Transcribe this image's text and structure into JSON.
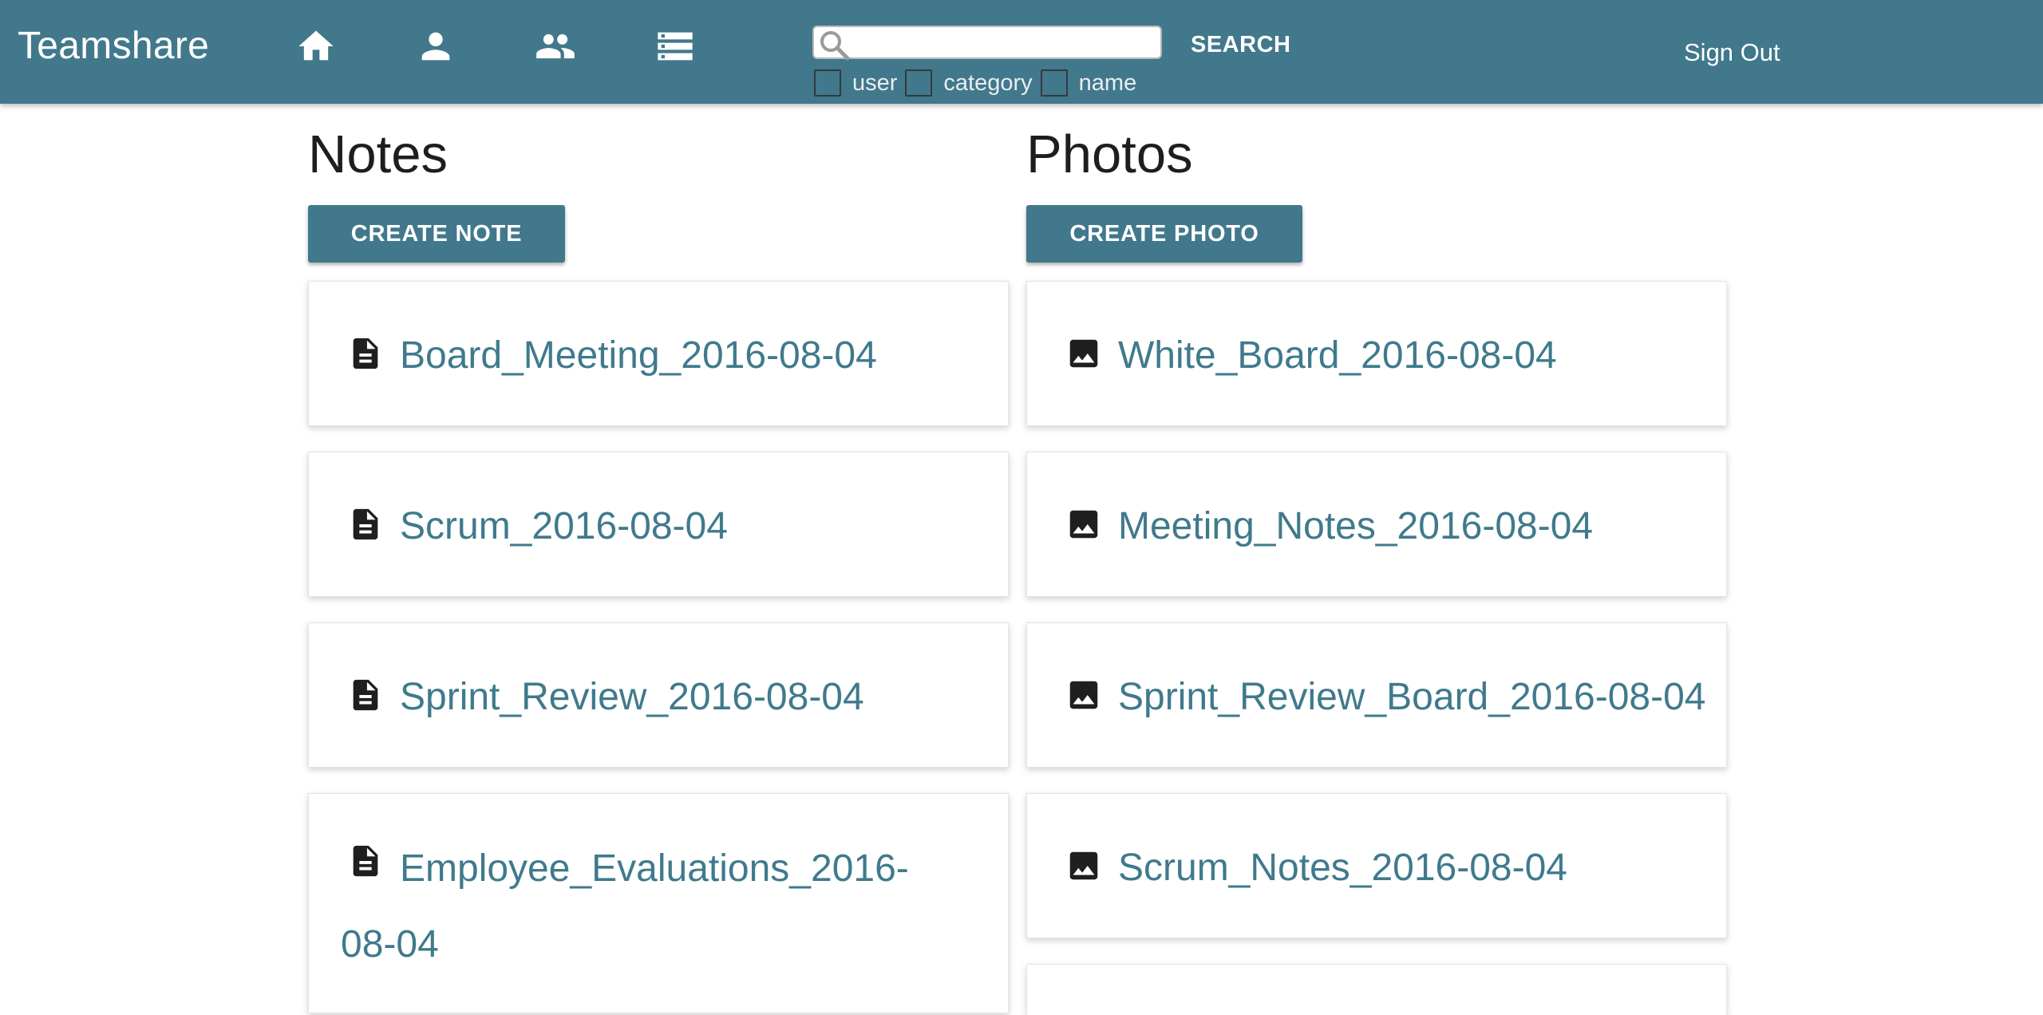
{
  "header": {
    "brand": "Teamshare",
    "nav_icons": [
      "home-icon",
      "person-icon",
      "people-icon",
      "list-icon"
    ],
    "search": {
      "value": "",
      "button_label": "SEARCH"
    },
    "filters": [
      {
        "label": "user",
        "checked": false
      },
      {
        "label": "category",
        "checked": false
      },
      {
        "label": "name",
        "checked": false
      }
    ],
    "sign_out_label": "Sign Out",
    "bar_color": "#41788c"
  },
  "notes": {
    "heading": "Notes",
    "create_label": "CREATE NOTE",
    "items": [
      {
        "name": "Board_Meeting_2016-08-04"
      },
      {
        "name": "Scrum_2016-08-04"
      },
      {
        "name": "Sprint_Review_2016-08-04"
      },
      {
        "name": "Employee_Evaluations_2016-08-04"
      }
    ]
  },
  "photos": {
    "heading": "Photos",
    "create_label": "CREATE PHOTO",
    "items": [
      {
        "name": "White_Board_2016-08-04"
      },
      {
        "name": "Meeting_Notes_2016-08-04"
      },
      {
        "name": "Sprint_Review_Board_2016-08-04"
      },
      {
        "name": "Scrum_Notes_2016-08-04"
      }
    ]
  },
  "link_color": "#3f7a8c"
}
